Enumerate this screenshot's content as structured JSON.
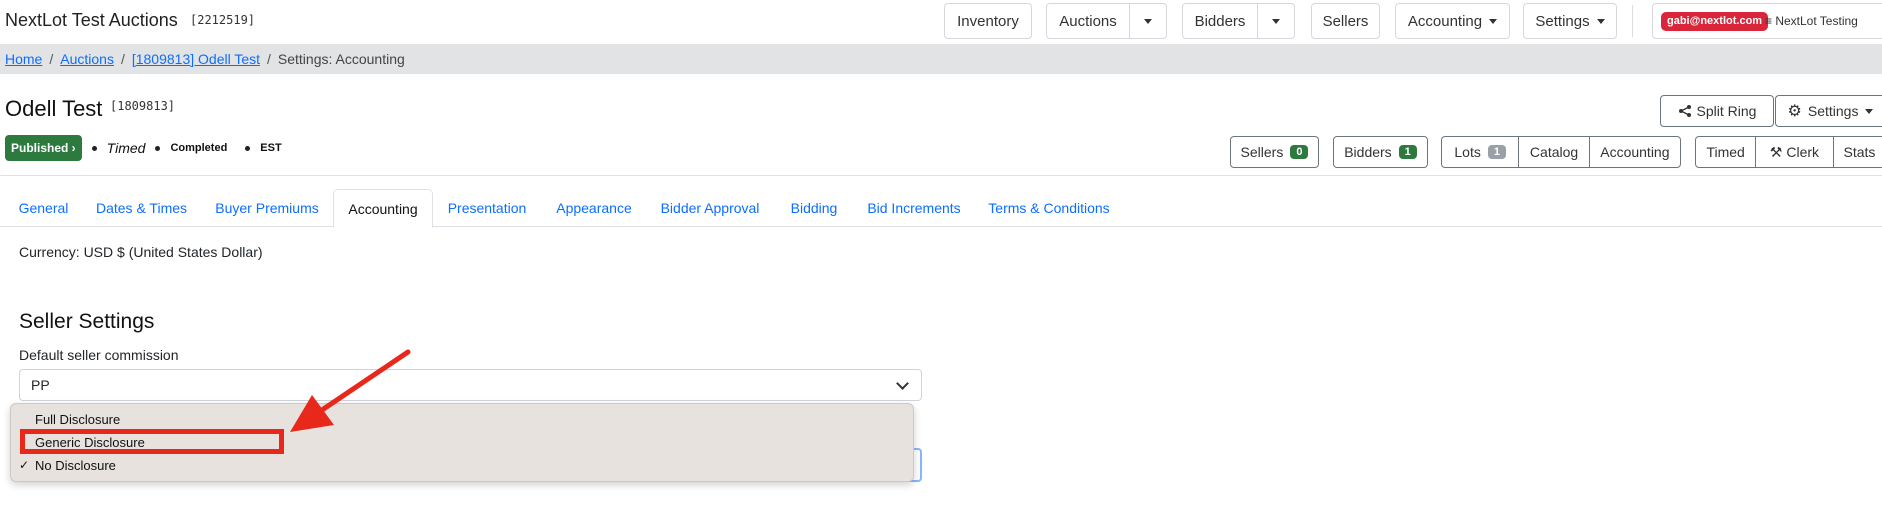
{
  "topbar": {
    "brand": "NextLot Test Auctions",
    "brand_id": "[2212519]",
    "nav": {
      "inventory": "Inventory",
      "auctions": "Auctions",
      "bidders": "Bidders",
      "sellers": "Sellers",
      "accounting": "Accounting",
      "settings": "Settings"
    },
    "user_email": "gabi@nextlot.com",
    "org": "≡ NextLot Testing"
  },
  "breadcrumb": {
    "home": "Home",
    "auctions": "Auctions",
    "auction": "[1809813] Odell Test",
    "current": "Settings: Accounting",
    "separator": "/"
  },
  "auction": {
    "title": "Odell Test",
    "id": "[1809813]",
    "status_badge": "Published ›",
    "type": "Timed",
    "state": "Completed",
    "timezone": "EST",
    "split_ring": "Split Ring",
    "settings": "Settings",
    "sellers": "Sellers",
    "sellers_count": "0",
    "bidders": "Bidders",
    "bidders_count": "1",
    "lots": "Lots",
    "lots_count": "1",
    "catalog": "Catalog",
    "accounting": "Accounting",
    "timed": "Timed",
    "clerk": "Clerk",
    "stats": "Stats"
  },
  "tabs": {
    "general": "General",
    "dates_times": "Dates & Times",
    "buyer_premiums": "Buyer Premiums",
    "accounting": "Accounting",
    "presentation": "Presentation",
    "appearance": "Appearance",
    "bidder_approval": "Bidder Approval",
    "bidding": "Bidding",
    "bid_increments": "Bid Increments",
    "terms": "Terms & Conditions"
  },
  "content": {
    "currency": "Currency: USD $ (United States Dollar)",
    "section_title": "Seller Settings",
    "commission_label": "Default seller commission",
    "commission_value": "PP"
  },
  "dropdown": {
    "options": [
      "Full Disclosure",
      "Generic Disclosure",
      "No Disclosure"
    ],
    "selected_mark": "✓"
  },
  "colors": {
    "link": "#0d6efd",
    "annotation": "#e8281b",
    "published": "#2d7a3f",
    "user_badge": "#d9263b"
  }
}
